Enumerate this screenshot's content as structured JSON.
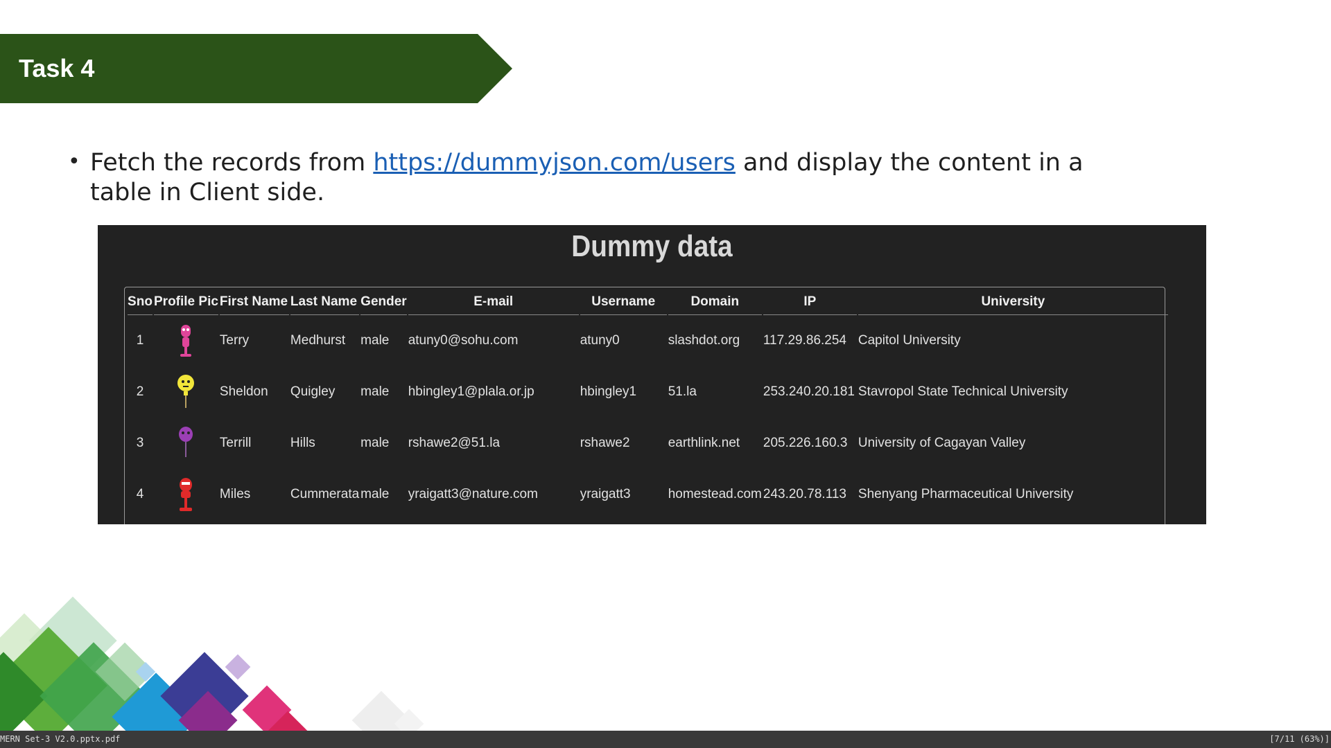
{
  "slide": {
    "title": "Task 4",
    "bullet_before": "Fetch the records from ",
    "bullet_link": "https://dummyjson.com/users",
    "bullet_after": " and display the content in a table in Client side."
  },
  "screenshot": {
    "title": "Dummy data",
    "headers": [
      "Sno",
      "Profile Pic",
      "First Name",
      "Last Name",
      "Gender",
      "E-mail",
      "Username",
      "Domain",
      "IP",
      "University"
    ],
    "rows": [
      {
        "sno": "1",
        "avatar_color": "#e0459a",
        "first": "Terry",
        "last": "Medhurst",
        "gender": "male",
        "email": "atuny0@sohu.com",
        "username": "atuny0",
        "domain": "slashdot.org",
        "ip": "117.29.86.254",
        "university": "Capitol University"
      },
      {
        "sno": "2",
        "avatar_color": "#f2e63a",
        "first": "Sheldon",
        "last": "Quigley",
        "gender": "male",
        "email": "hbingley1@plala.or.jp",
        "username": "hbingley1",
        "domain": "51.la",
        "ip": "253.240.20.181",
        "university": "Stavropol State Technical University"
      },
      {
        "sno": "3",
        "avatar_color": "#9b3fb5",
        "first": "Terrill",
        "last": "Hills",
        "gender": "male",
        "email": "rshawe2@51.la",
        "username": "rshawe2",
        "domain": "earthlink.net",
        "ip": "205.226.160.3",
        "university": "University of Cagayan Valley"
      },
      {
        "sno": "4",
        "avatar_color": "#e02a2a",
        "first": "Miles",
        "last": "Cummerata",
        "gender": "male",
        "email": "yraigatt3@nature.com",
        "username": "yraigatt3",
        "domain": "homestead.com",
        "ip": "243.20.78.113",
        "university": "Shenyang Pharmaceutical University"
      }
    ]
  },
  "viewer": {
    "filename": "MERN Set-3 V2.0.pptx.pdf",
    "page_info": "[7/11 (63%)]"
  },
  "colors": {
    "banner": "#2b5318",
    "panel_bg": "#222222",
    "link": "#1a5fb4",
    "statusbar": "#3a3a3a"
  }
}
